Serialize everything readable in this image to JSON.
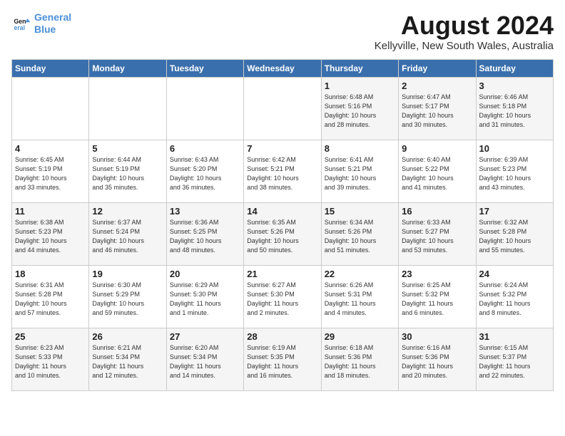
{
  "logo": {
    "line1": "General",
    "line2": "Blue"
  },
  "title": "August 2024",
  "subtitle": "Kellyville, New South Wales, Australia",
  "headers": [
    "Sunday",
    "Monday",
    "Tuesday",
    "Wednesday",
    "Thursday",
    "Friday",
    "Saturday"
  ],
  "weeks": [
    [
      {
        "day": "",
        "info": ""
      },
      {
        "day": "",
        "info": ""
      },
      {
        "day": "",
        "info": ""
      },
      {
        "day": "",
        "info": ""
      },
      {
        "day": "1",
        "info": "Sunrise: 6:48 AM\nSunset: 5:16 PM\nDaylight: 10 hours\nand 28 minutes."
      },
      {
        "day": "2",
        "info": "Sunrise: 6:47 AM\nSunset: 5:17 PM\nDaylight: 10 hours\nand 30 minutes."
      },
      {
        "day": "3",
        "info": "Sunrise: 6:46 AM\nSunset: 5:18 PM\nDaylight: 10 hours\nand 31 minutes."
      }
    ],
    [
      {
        "day": "4",
        "info": "Sunrise: 6:45 AM\nSunset: 5:19 PM\nDaylight: 10 hours\nand 33 minutes."
      },
      {
        "day": "5",
        "info": "Sunrise: 6:44 AM\nSunset: 5:19 PM\nDaylight: 10 hours\nand 35 minutes."
      },
      {
        "day": "6",
        "info": "Sunrise: 6:43 AM\nSunset: 5:20 PM\nDaylight: 10 hours\nand 36 minutes."
      },
      {
        "day": "7",
        "info": "Sunrise: 6:42 AM\nSunset: 5:21 PM\nDaylight: 10 hours\nand 38 minutes."
      },
      {
        "day": "8",
        "info": "Sunrise: 6:41 AM\nSunset: 5:21 PM\nDaylight: 10 hours\nand 39 minutes."
      },
      {
        "day": "9",
        "info": "Sunrise: 6:40 AM\nSunset: 5:22 PM\nDaylight: 10 hours\nand 41 minutes."
      },
      {
        "day": "10",
        "info": "Sunrise: 6:39 AM\nSunset: 5:23 PM\nDaylight: 10 hours\nand 43 minutes."
      }
    ],
    [
      {
        "day": "11",
        "info": "Sunrise: 6:38 AM\nSunset: 5:23 PM\nDaylight: 10 hours\nand 44 minutes."
      },
      {
        "day": "12",
        "info": "Sunrise: 6:37 AM\nSunset: 5:24 PM\nDaylight: 10 hours\nand 46 minutes."
      },
      {
        "day": "13",
        "info": "Sunrise: 6:36 AM\nSunset: 5:25 PM\nDaylight: 10 hours\nand 48 minutes."
      },
      {
        "day": "14",
        "info": "Sunrise: 6:35 AM\nSunset: 5:26 PM\nDaylight: 10 hours\nand 50 minutes."
      },
      {
        "day": "15",
        "info": "Sunrise: 6:34 AM\nSunset: 5:26 PM\nDaylight: 10 hours\nand 51 minutes."
      },
      {
        "day": "16",
        "info": "Sunrise: 6:33 AM\nSunset: 5:27 PM\nDaylight: 10 hours\nand 53 minutes."
      },
      {
        "day": "17",
        "info": "Sunrise: 6:32 AM\nSunset: 5:28 PM\nDaylight: 10 hours\nand 55 minutes."
      }
    ],
    [
      {
        "day": "18",
        "info": "Sunrise: 6:31 AM\nSunset: 5:28 PM\nDaylight: 10 hours\nand 57 minutes."
      },
      {
        "day": "19",
        "info": "Sunrise: 6:30 AM\nSunset: 5:29 PM\nDaylight: 10 hours\nand 59 minutes."
      },
      {
        "day": "20",
        "info": "Sunrise: 6:29 AM\nSunset: 5:30 PM\nDaylight: 11 hours\nand 1 minute."
      },
      {
        "day": "21",
        "info": "Sunrise: 6:27 AM\nSunset: 5:30 PM\nDaylight: 11 hours\nand 2 minutes."
      },
      {
        "day": "22",
        "info": "Sunrise: 6:26 AM\nSunset: 5:31 PM\nDaylight: 11 hours\nand 4 minutes."
      },
      {
        "day": "23",
        "info": "Sunrise: 6:25 AM\nSunset: 5:32 PM\nDaylight: 11 hours\nand 6 minutes."
      },
      {
        "day": "24",
        "info": "Sunrise: 6:24 AM\nSunset: 5:32 PM\nDaylight: 11 hours\nand 8 minutes."
      }
    ],
    [
      {
        "day": "25",
        "info": "Sunrise: 6:23 AM\nSunset: 5:33 PM\nDaylight: 11 hours\nand 10 minutes."
      },
      {
        "day": "26",
        "info": "Sunrise: 6:21 AM\nSunset: 5:34 PM\nDaylight: 11 hours\nand 12 minutes."
      },
      {
        "day": "27",
        "info": "Sunrise: 6:20 AM\nSunset: 5:34 PM\nDaylight: 11 hours\nand 14 minutes."
      },
      {
        "day": "28",
        "info": "Sunrise: 6:19 AM\nSunset: 5:35 PM\nDaylight: 11 hours\nand 16 minutes."
      },
      {
        "day": "29",
        "info": "Sunrise: 6:18 AM\nSunset: 5:36 PM\nDaylight: 11 hours\nand 18 minutes."
      },
      {
        "day": "30",
        "info": "Sunrise: 6:16 AM\nSunset: 5:36 PM\nDaylight: 11 hours\nand 20 minutes."
      },
      {
        "day": "31",
        "info": "Sunrise: 6:15 AM\nSunset: 5:37 PM\nDaylight: 11 hours\nand 22 minutes."
      }
    ]
  ]
}
